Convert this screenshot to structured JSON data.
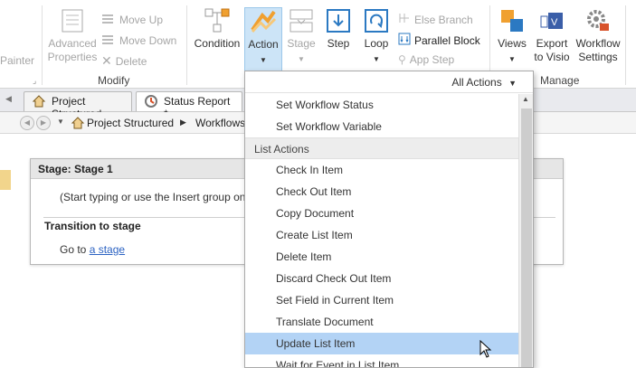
{
  "ribbon": {
    "painter": "Painter",
    "advanced_properties": "Advanced Properties",
    "move_up": "Move Up",
    "move_down": "Move Down",
    "delete": "Delete",
    "modify_group": "Modify",
    "condition": "Condition",
    "action": "Action",
    "stage": "Stage",
    "step": "Step",
    "loop": "Loop",
    "else_branch": "Else Branch",
    "parallel_block": "Parallel Block",
    "app_step": "App Step",
    "views": "Views",
    "export_to_visio": "Export to Visio",
    "workflow_settings": "Workflow Settings",
    "manage_group": "Manage"
  },
  "tabs": [
    {
      "label": "Project Structured"
    },
    {
      "label": "Status Report *"
    }
  ],
  "breadcrumb": {
    "item1": "Project Structured",
    "item2": "Workflows"
  },
  "stage": {
    "title": "Stage: Stage 1",
    "hint": "(Start typing or use the Insert group on",
    "transition_heading": "Transition to stage",
    "goto_text": "Go to",
    "goto_link": "a stage"
  },
  "dropdown": {
    "filter_label": "All Actions",
    "items_top": [
      "Set Workflow Status",
      "Set Workflow Variable"
    ],
    "category": "List Actions",
    "items": [
      "Check In Item",
      "Check Out Item",
      "Copy Document",
      "Create List Item",
      "Delete Item",
      "Discard Check Out Item",
      "Set Field in Current Item",
      "Translate Document",
      "Update List Item",
      "Wait for Event in List Item"
    ],
    "highlighted_index": 8
  },
  "colors": {
    "accent": "#2b79c2",
    "highlight": "#b3d3f5",
    "stage_head": "#e6e6e6"
  }
}
